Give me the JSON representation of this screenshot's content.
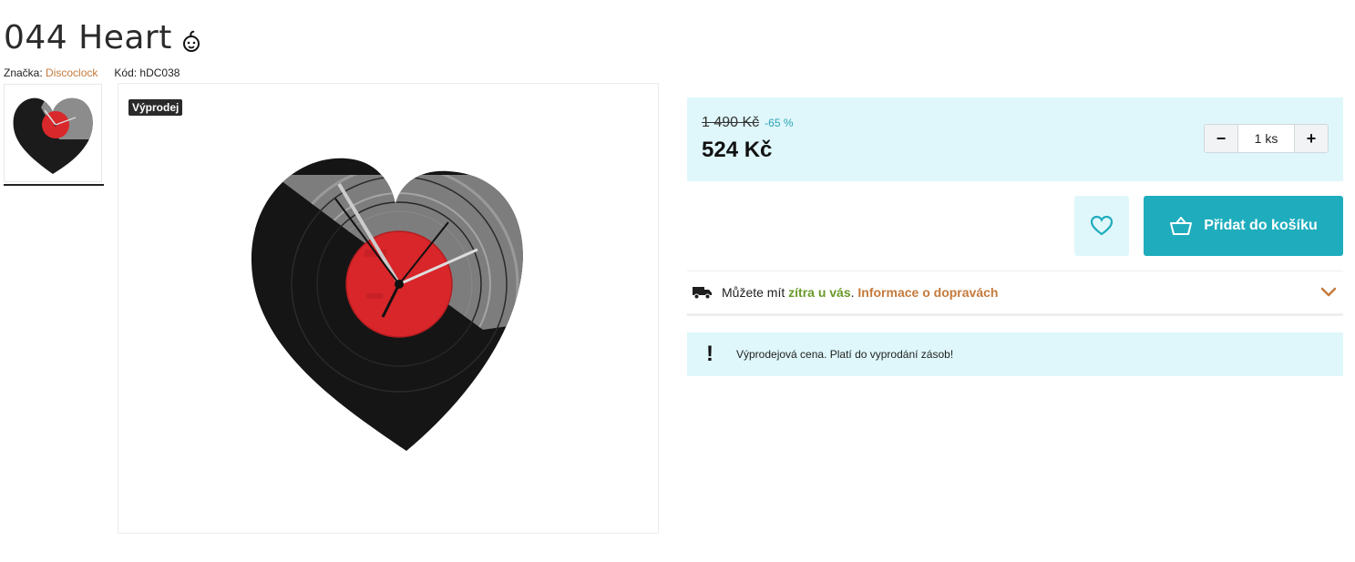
{
  "product": {
    "title": "044 Heart",
    "brand_label": "Značka:",
    "brand_name": "Discoclock",
    "code_label": "Kód:",
    "code_value": "hDC038",
    "badge": "Výprodej"
  },
  "price": {
    "old": "1 490 Kč",
    "discount": "-65 %",
    "current": "524 Kč"
  },
  "quantity": {
    "value": "1 ks",
    "minus": "−",
    "plus": "+"
  },
  "actions": {
    "add_to_cart": "Přidat do košíku"
  },
  "delivery": {
    "text_before": "Můžete mít ",
    "highlight": "zítra u vás",
    "text_after": ". ",
    "link": "Informace o dopravách"
  },
  "notice": {
    "mark": "!",
    "text": "Výprodejová cena. Platí do vyprodání zásob!"
  },
  "colors": {
    "accent": "#1fadbd",
    "light_accent": "#dff7fb",
    "brand_link": "#c47a3d",
    "green": "#6a9a2a"
  },
  "icons": {
    "title": "baby-face-icon",
    "wishlist": "heart-outline-icon",
    "cart": "basket-icon",
    "delivery": "truck-icon",
    "expand": "chevron-down-icon"
  }
}
